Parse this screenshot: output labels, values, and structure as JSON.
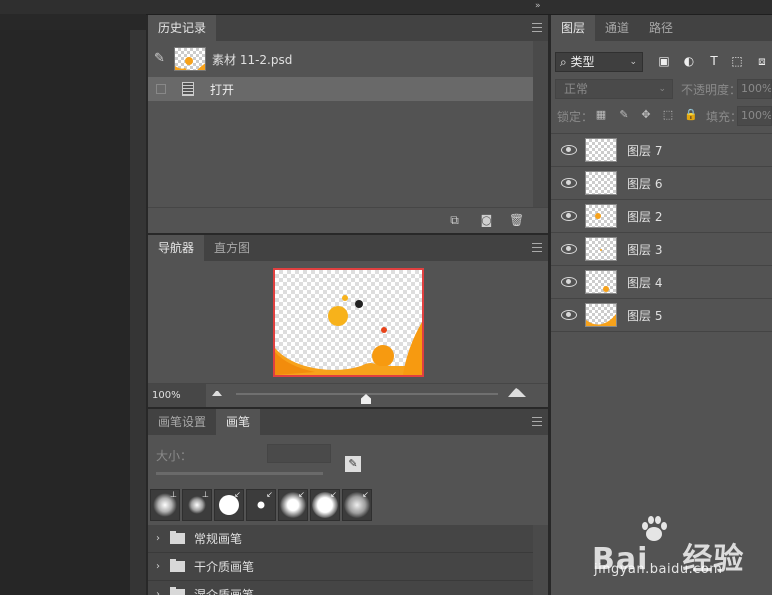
{
  "top": {
    "collapse_glyph": "»"
  },
  "history": {
    "tabs": [
      {
        "label": "历史记录",
        "active": true
      }
    ],
    "snapshot_name": "素材 11-2.psd",
    "steps": [
      {
        "label": "打开",
        "selected": true
      }
    ],
    "footer_icons": [
      "new-document-from-state-icon",
      "snapshot-camera-icon",
      "trash-icon"
    ]
  },
  "navigator": {
    "tabs": [
      {
        "label": "导航器",
        "active": true
      },
      {
        "label": "直方图",
        "active": false
      }
    ],
    "zoom": "100%",
    "zoom_slider_fraction": 0.5
  },
  "brushes": {
    "tabs": [
      {
        "label": "画笔设置",
        "active": false
      },
      {
        "label": "画笔",
        "active": true
      }
    ],
    "size_label": "大小：",
    "groups": [
      {
        "label": "常规画笔"
      },
      {
        "label": "干介质画笔"
      },
      {
        "label": "湿介质画笔"
      }
    ]
  },
  "layers": {
    "tabs": [
      {
        "label": "图层",
        "active": true
      },
      {
        "label": "通道",
        "active": false
      },
      {
        "label": "路径",
        "active": false
      }
    ],
    "filter_kind": "类型",
    "blend_mode": "正常",
    "opacity_label": "不透明度：",
    "opacity_value": "100%",
    "lock_label": "锁定：",
    "fill_label": "填充：",
    "fill_value": "100%",
    "items": [
      {
        "name": "图层 7"
      },
      {
        "name": "图层 6"
      },
      {
        "name": "图层 2"
      },
      {
        "name": "图层 3"
      },
      {
        "name": "图层 4"
      },
      {
        "name": "图层 5"
      }
    ]
  },
  "watermark": {
    "brand": "Bai",
    "brand2": "经验",
    "url": "jingyan.baidu.com"
  },
  "colors": {
    "accent_orange": "#f7a21b",
    "nav_border": "#e04040"
  }
}
